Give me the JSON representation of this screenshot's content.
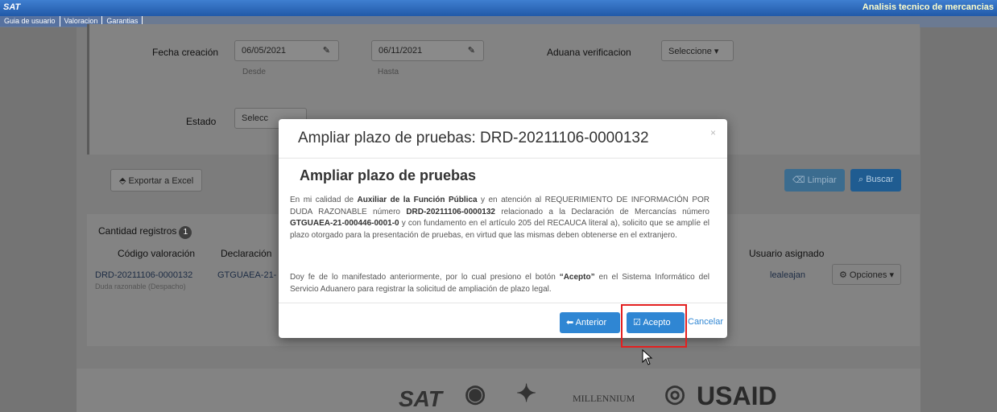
{
  "app": {
    "logo": "SAT",
    "title": "Analisis tecnico de mercancias"
  },
  "nav": {
    "tabs": [
      "Guia de usuario",
      "Valoracion",
      "Garantias"
    ]
  },
  "filters": {
    "fecha_label": "Fecha creación",
    "desde_value": "06/05/2021",
    "desde_hint": "Desde",
    "hasta_value": "06/11/2021",
    "hasta_hint": "Hasta",
    "aduana_label": "Aduana verificacion",
    "aduana_select": "Seleccione ▾",
    "estado_label": "Estado",
    "estado_select": "Selecc"
  },
  "toolbar": {
    "export_label": "Exportar a Excel",
    "limpiar_label": "Limpiar",
    "buscar_label": "Buscar"
  },
  "results": {
    "count_label": "Cantidad registros",
    "count": "1",
    "headers": [
      "Código valoración",
      "Declaración",
      "Usuario asignado"
    ],
    "row": {
      "codigo": "DRD-20211106-0000132",
      "codigo_sub": "Duda razonable (Despacho)",
      "declaracion": "GTGUAEA-21-",
      "usuario": "lealeajan",
      "opciones": "Opciones ▾"
    }
  },
  "footer": {
    "logos": [
      "SAT",
      "MILLENNIUM",
      "USAID"
    ]
  },
  "modal": {
    "title": "Ampliar plazo de pruebas: DRD-20211106-0000132",
    "close": "×",
    "heading": "Ampliar plazo de pruebas",
    "p1_parts": [
      "En mi calidad de ",
      "Auxiliar de la Función Pública",
      " y en atención al REQUERIMIENTO DE INFORMACIÓN POR DUDA RAZONABLE número ",
      "DRD-20211106-0000132",
      " relacionado a la Declaración de Mercancías número ",
      "GTGUAEA-21-000446-0001-0",
      " y con fundamento en el artículo 205 del RECAUCA literal a), solicito que se amplíe el plazo otorgado para la presentación de pruebas, en virtud que las mismas deben obtenerse en el extranjero."
    ],
    "p2_parts": [
      "Doy fe de lo manifestado anteriormente, por lo cual presiono el botón ",
      "“Acepto”",
      " en el Sistema Informático del Servicio Aduanero para registrar la solicitud de ampliación de plazo legal."
    ],
    "anterior_label": "Anterior",
    "acepto_label": "Acepto",
    "cancelar_label": "Cancelar"
  },
  "colors": {
    "primary": "#2f86d3",
    "highlight": "#e32020",
    "appbar": "#2159a8"
  }
}
